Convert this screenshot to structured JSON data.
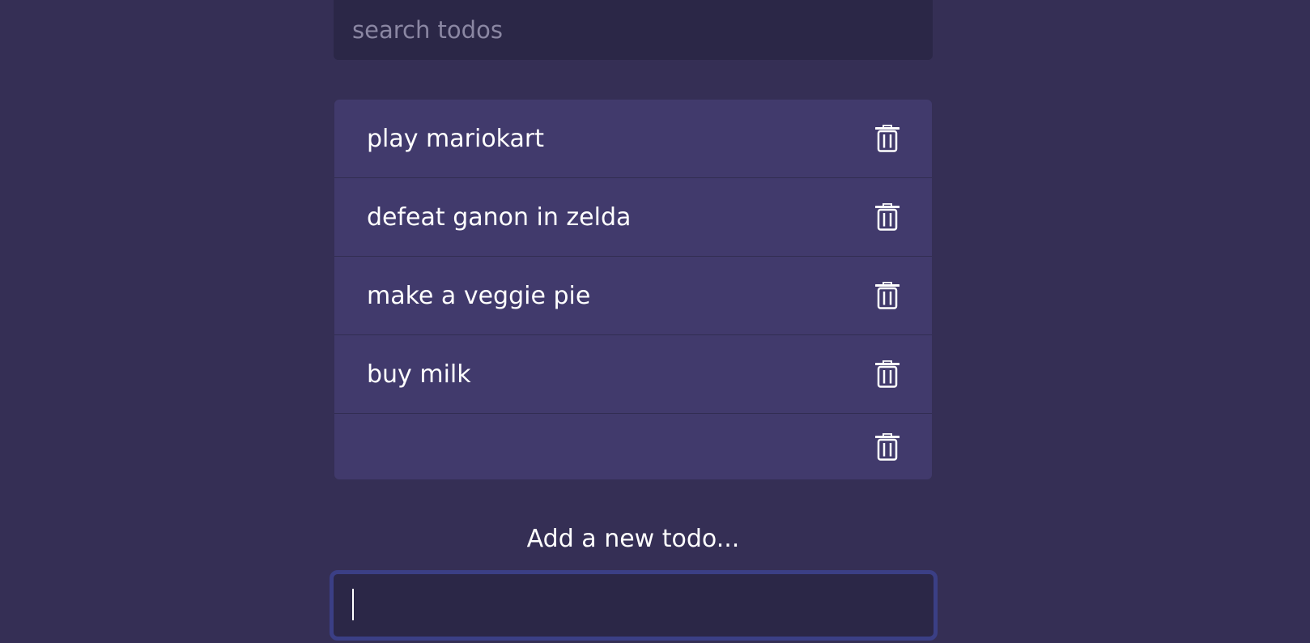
{
  "search": {
    "placeholder": "search todos",
    "value": ""
  },
  "todos": [
    {
      "text": "play mariokart"
    },
    {
      "text": "defeat ganon in zelda"
    },
    {
      "text": "make a veggie pie"
    },
    {
      "text": "buy milk"
    },
    {
      "text": ""
    }
  ],
  "add": {
    "label": "Add a new todo...",
    "value": ""
  },
  "icons": {
    "delete": "trash-icon"
  },
  "colors": {
    "background": "#352f55",
    "list_background": "#413a6c",
    "input_background": "#2b2747",
    "focus_border": "#3b3f85",
    "text": "#ffffff",
    "placeholder": "#8b87a3"
  }
}
